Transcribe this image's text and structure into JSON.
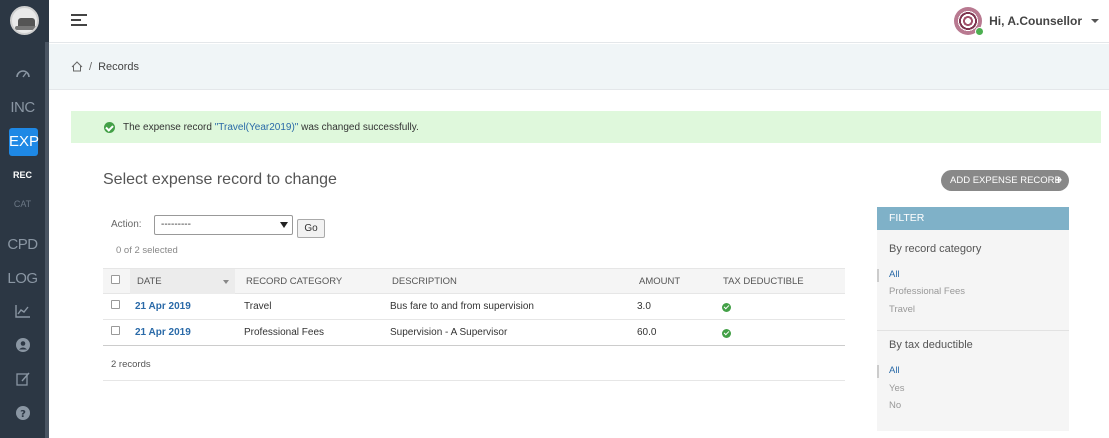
{
  "sidebar": {
    "items": [
      {
        "label": "INC"
      },
      {
        "label": "EXP"
      },
      {
        "label": "REC"
      },
      {
        "label": "CAT"
      },
      {
        "label": "CPD"
      },
      {
        "label": "LOG"
      }
    ]
  },
  "topbar": {
    "user_greeting": "Hi, A.Counsellor"
  },
  "breadcrumb": {
    "separator": "/",
    "current": "Records"
  },
  "message": {
    "prefix": "The expense record ",
    "link": "\"Travel(Year2019)\"",
    "suffix": " was changed successfully."
  },
  "main": {
    "title": "Select expense record to change",
    "add_button": "ADD EXPENSE RECORD",
    "action_label": "Action:",
    "action_select_value": "---------",
    "go_button": "Go",
    "selected_count": "0 of 2 selected",
    "records_count": "2 records"
  },
  "table": {
    "headers": [
      "DATE",
      "RECORD CATEGORY",
      "DESCRIPTION",
      "AMOUNT",
      "TAX DEDUCTIBLE"
    ],
    "rows": [
      {
        "date": "21 Apr 2019",
        "category": "Travel",
        "description": "Bus fare to and from supervision",
        "amount": "3.0",
        "tax_deductible": true
      },
      {
        "date": "21 Apr 2019",
        "category": "Professional Fees",
        "description": "Supervision - A Supervisor",
        "amount": "60.0",
        "tax_deductible": true
      }
    ]
  },
  "filter": {
    "title": "FILTER",
    "groups": [
      {
        "heading": "By record category",
        "options": [
          "All",
          "Professional Fees",
          "Travel"
        ],
        "selected": "All"
      },
      {
        "heading": "By tax deductible",
        "options": [
          "All",
          "Yes",
          "No"
        ],
        "selected": "All"
      }
    ]
  },
  "colors": {
    "sidebar_bg": "#2c3744",
    "active_nav": "#1e88e5",
    "link": "#2a6aa8",
    "success_bg": "#dff8dc",
    "filter_header": "#7fb1c8"
  }
}
